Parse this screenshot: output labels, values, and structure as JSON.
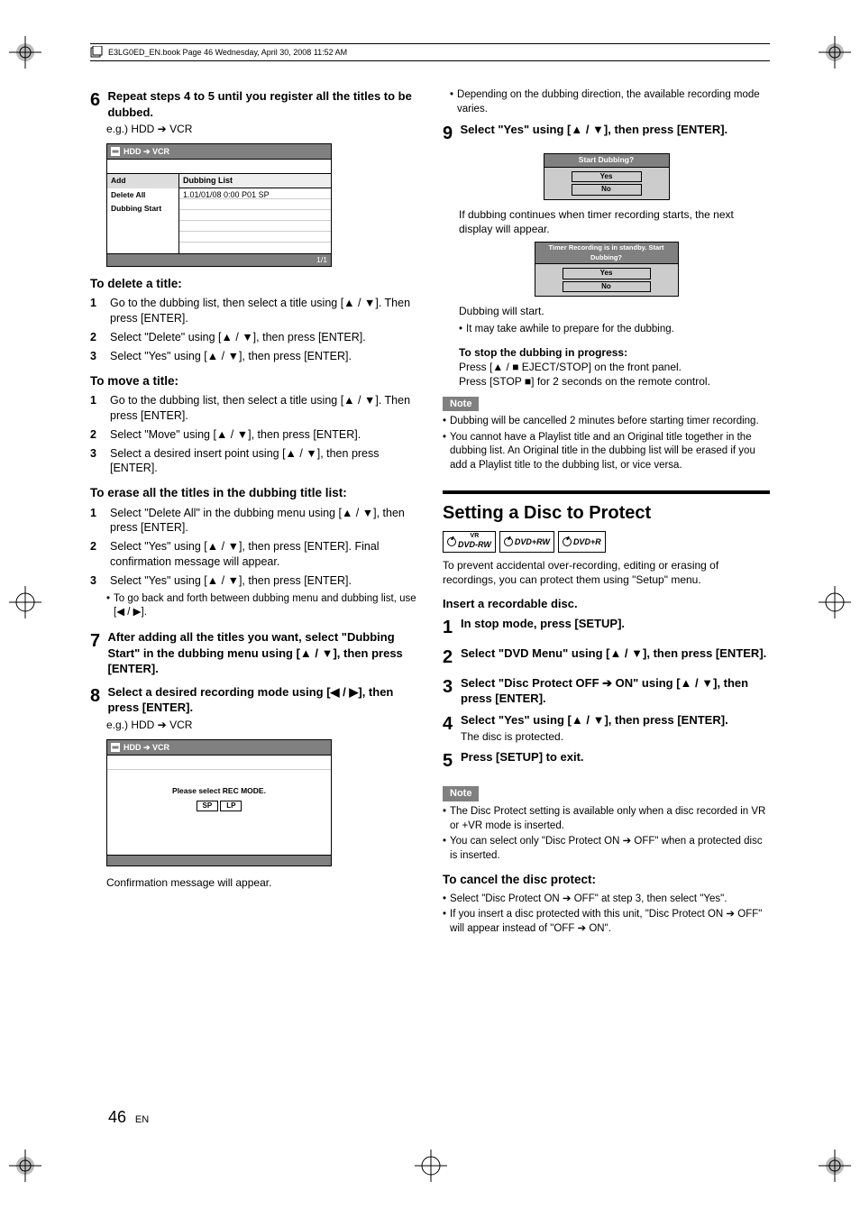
{
  "header": {
    "book_info": "E3LG0ED_EN.book  Page 46  Wednesday, April 30, 2008  11:52 AM"
  },
  "left": {
    "step6": {
      "num": "6",
      "text": "Repeat steps 4 to 5 until you register all the titles to be dubbed.",
      "eg": "e.g.) HDD ➔ VCR"
    },
    "dub_screen": {
      "title": "HDD ➔ VCR",
      "side_items": [
        "Add",
        "Delete All",
        "Dubbing Start"
      ],
      "list_header": "Dubbing List",
      "list_row1": "1.01/01/08 0:00 P01 SP",
      "footer": "1/1"
    },
    "delete": {
      "head": "To delete a title:",
      "items": [
        {
          "n": "1",
          "t": "Go to the dubbing list, then select a title using [▲ / ▼]. Then press [ENTER]."
        },
        {
          "n": "2",
          "t": "Select \"Delete\" using [▲ / ▼], then press [ENTER]."
        },
        {
          "n": "3",
          "t": "Select \"Yes\" using [▲ / ▼], then press [ENTER]."
        }
      ]
    },
    "move": {
      "head": "To move a title:",
      "items": [
        {
          "n": "1",
          "t": "Go to the dubbing list, then select a title using [▲ / ▼]. Then press [ENTER]."
        },
        {
          "n": "2",
          "t": "Select \"Move\" using [▲ / ▼], then press [ENTER]."
        },
        {
          "n": "3",
          "t": "Select a desired insert point using [▲ / ▼], then press [ENTER]."
        }
      ]
    },
    "erase": {
      "head": "To erase all the titles in the dubbing title list:",
      "items": [
        {
          "n": "1",
          "t": "Select \"Delete All\" in the dubbing menu using [▲ / ▼], then press [ENTER]."
        },
        {
          "n": "2",
          "t": "Select \"Yes\" using [▲ / ▼], then press [ENTER]. Final confirmation message will appear."
        },
        {
          "n": "3",
          "t": "Select \"Yes\" using [▲ / ▼], then press [ENTER]."
        }
      ],
      "note": "To go back and forth between dubbing menu and dubbing list, use [◀ / ▶]."
    },
    "step7": {
      "num": "7",
      "text": "After adding all the titles you want, select \"Dubbing Start\" in the dubbing menu using [▲ / ▼], then press [ENTER]."
    },
    "step8": {
      "num": "8",
      "text": "Select a desired recording mode using [◀ / ▶], then press [ENTER].",
      "eg": "e.g.) HDD ➔ VCR"
    },
    "rec_screen": {
      "title": "HDD ➔ VCR",
      "msg": "Please select REC MODE.",
      "modes": [
        "SP",
        "LP"
      ]
    },
    "confirm": "Confirmation message will appear."
  },
  "right": {
    "top_bullet": "Depending on the dubbing direction, the available recording mode varies.",
    "step9": {
      "num": "9",
      "text": "Select \"Yes\" using [▲ / ▼], then press [ENTER]."
    },
    "dialog1": {
      "hdr": "Start Dubbing?",
      "yes": "Yes",
      "no": "No"
    },
    "after_dialog1": "If dubbing continues when timer recording starts, the next display will appear.",
    "dialog2": {
      "hdr": "Timer Recording is in standby. Start Dubbing?",
      "yes": "Yes",
      "no": "No"
    },
    "dub_start": "Dubbing will start.",
    "dub_start_bullet": "It may take awhile to prepare for the dubbing.",
    "stop_head": "To stop the dubbing in progress:",
    "stop_line1": "Press [▲ / ■ EJECT/STOP] on the front panel.",
    "stop_line2": "Press [STOP ■] for 2 seconds on the remote control.",
    "note_label": "Note",
    "notes": [
      "Dubbing will be cancelled 2 minutes before starting timer recording.",
      "You cannot have a Playlist title and an Original title together in the dubbing list. An Original title in the dubbing list will be erased if you add a Playlist title to the dubbing list, or vice versa."
    ],
    "section_title": "Setting a Disc to Protect",
    "badges": [
      "DVD-RW",
      "DVD+RW",
      "DVD+R"
    ],
    "badge_vr": "VR",
    "protect_intro": "To prevent accidental over-recording, editing or erasing of recordings, you can protect them using \"Setup\" menu.",
    "insert": "Insert a recordable disc.",
    "psteps": [
      {
        "n": "1",
        "t": "In stop mode, press [SETUP]."
      },
      {
        "n": "2",
        "t": "Select \"DVD Menu\" using [▲ / ▼], then press [ENTER]."
      },
      {
        "n": "3",
        "t": "Select \"Disc Protect OFF ➔ ON\" using [▲ / ▼], then press [ENTER]."
      },
      {
        "n": "4",
        "t": "Select \"Yes\" using [▲ / ▼], then press [ENTER].",
        "sub": "The disc is protected."
      },
      {
        "n": "5",
        "t": "Press [SETUP] to exit."
      }
    ],
    "notes2": [
      "The Disc Protect setting is available only when a disc recorded in VR or +VR mode is inserted.",
      "You can select only \"Disc Protect ON ➔ OFF\" when a protected disc is inserted."
    ],
    "cancel_head": "To cancel the disc protect:",
    "cancel_items": [
      "Select \"Disc Protect ON ➔ OFF\" at step 3, then select \"Yes\".",
      "If you insert a disc protected with this unit, \"Disc Protect ON ➔ OFF\" will appear instead of \"OFF ➔ ON\"."
    ]
  },
  "page_number": "46",
  "page_lang": "EN"
}
